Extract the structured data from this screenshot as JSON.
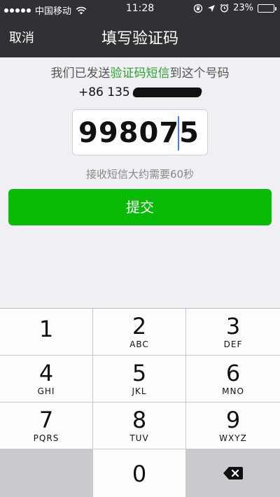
{
  "status_bar": {
    "carrier": "中国移动",
    "time": "11:28",
    "battery": "23%",
    "battery_level": 0.23
  },
  "nav": {
    "back_label": "取消",
    "title": "填写验证码"
  },
  "content": {
    "desc_prefix": "我们已发送",
    "desc_highlight": "验证码短信",
    "desc_suffix": "到这个号码",
    "phone_visible": "+86 135",
    "code_value": "998075",
    "hint": "接收短信大约需要60秒",
    "submit_label": "提交"
  },
  "colors": {
    "accent_green": "#09bb07",
    "highlight_green": "#2aa62a",
    "header_bg": "#2f3134"
  },
  "keypad": {
    "keys": [
      {
        "num": "1",
        "letters": ""
      },
      {
        "num": "2",
        "letters": "ABC"
      },
      {
        "num": "3",
        "letters": "DEF"
      },
      {
        "num": "4",
        "letters": "GHI"
      },
      {
        "num": "5",
        "letters": "JKL"
      },
      {
        "num": "6",
        "letters": "MNO"
      },
      {
        "num": "7",
        "letters": "PQRS"
      },
      {
        "num": "8",
        "letters": "TUV"
      },
      {
        "num": "9",
        "letters": "WXYZ"
      },
      {
        "num": "0",
        "letters": ""
      }
    ]
  }
}
